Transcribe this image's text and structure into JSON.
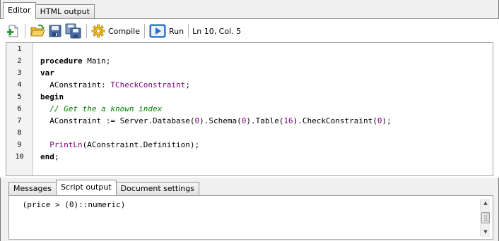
{
  "top_tabs": [
    {
      "label": "Editor",
      "active": true
    },
    {
      "label": "HTML output",
      "active": false
    }
  ],
  "toolbar": {
    "new_icon": "new-file-icon",
    "open_icon": "open-folder-icon",
    "save_icon": "save-icon",
    "save_all_icon": "save-all-icon",
    "compile_icon": "gear-icon",
    "compile_label": "Compile",
    "run_icon": "play-icon",
    "run_label": "Run",
    "status": "Ln 10, Col. 5"
  },
  "gutter": [
    "1",
    "2",
    "3",
    "4",
    "5",
    "6",
    "7",
    "8",
    "9",
    "10"
  ],
  "code_lines": [
    [],
    [
      {
        "t": "procedure",
        "c": "kw"
      },
      {
        "t": " Main;",
        "c": ""
      }
    ],
    [
      {
        "t": "var",
        "c": "kw"
      }
    ],
    [
      {
        "t": "  AConstraint: ",
        "c": ""
      },
      {
        "t": "TCheckConstraint",
        "c": "ty"
      },
      {
        "t": ";",
        "c": ""
      }
    ],
    [
      {
        "t": "begin",
        "c": "kw"
      }
    ],
    [
      {
        "t": "  // Get the a known index",
        "c": "cm"
      }
    ],
    [
      {
        "t": "  AConstraint := Server.Database(",
        "c": ""
      },
      {
        "t": "0",
        "c": "nm"
      },
      {
        "t": ").Schema(",
        "c": ""
      },
      {
        "t": "0",
        "c": "nm"
      },
      {
        "t": ").Table(",
        "c": ""
      },
      {
        "t": "16",
        "c": "nm"
      },
      {
        "t": ").CheckConstraint(",
        "c": ""
      },
      {
        "t": "0",
        "c": "nm"
      },
      {
        "t": ");",
        "c": ""
      }
    ],
    [],
    [
      {
        "t": "  ",
        "c": ""
      },
      {
        "t": "PrintLn",
        "c": "ty"
      },
      {
        "t": "(AConstraint.Definition);",
        "c": ""
      }
    ],
    [
      {
        "t": "end",
        "c": "kw"
      },
      {
        "t": ";",
        "c": ""
      }
    ]
  ],
  "bottom_tabs": [
    {
      "label": "Messages",
      "active": false
    },
    {
      "label": "Script output",
      "active": true
    },
    {
      "label": "Document settings",
      "active": false
    }
  ],
  "output": {
    "text": " (price > (0)::numeric)"
  },
  "colors": {
    "keyword": "#000000",
    "type": "#800080",
    "comment": "#008000",
    "number": "#800080"
  }
}
